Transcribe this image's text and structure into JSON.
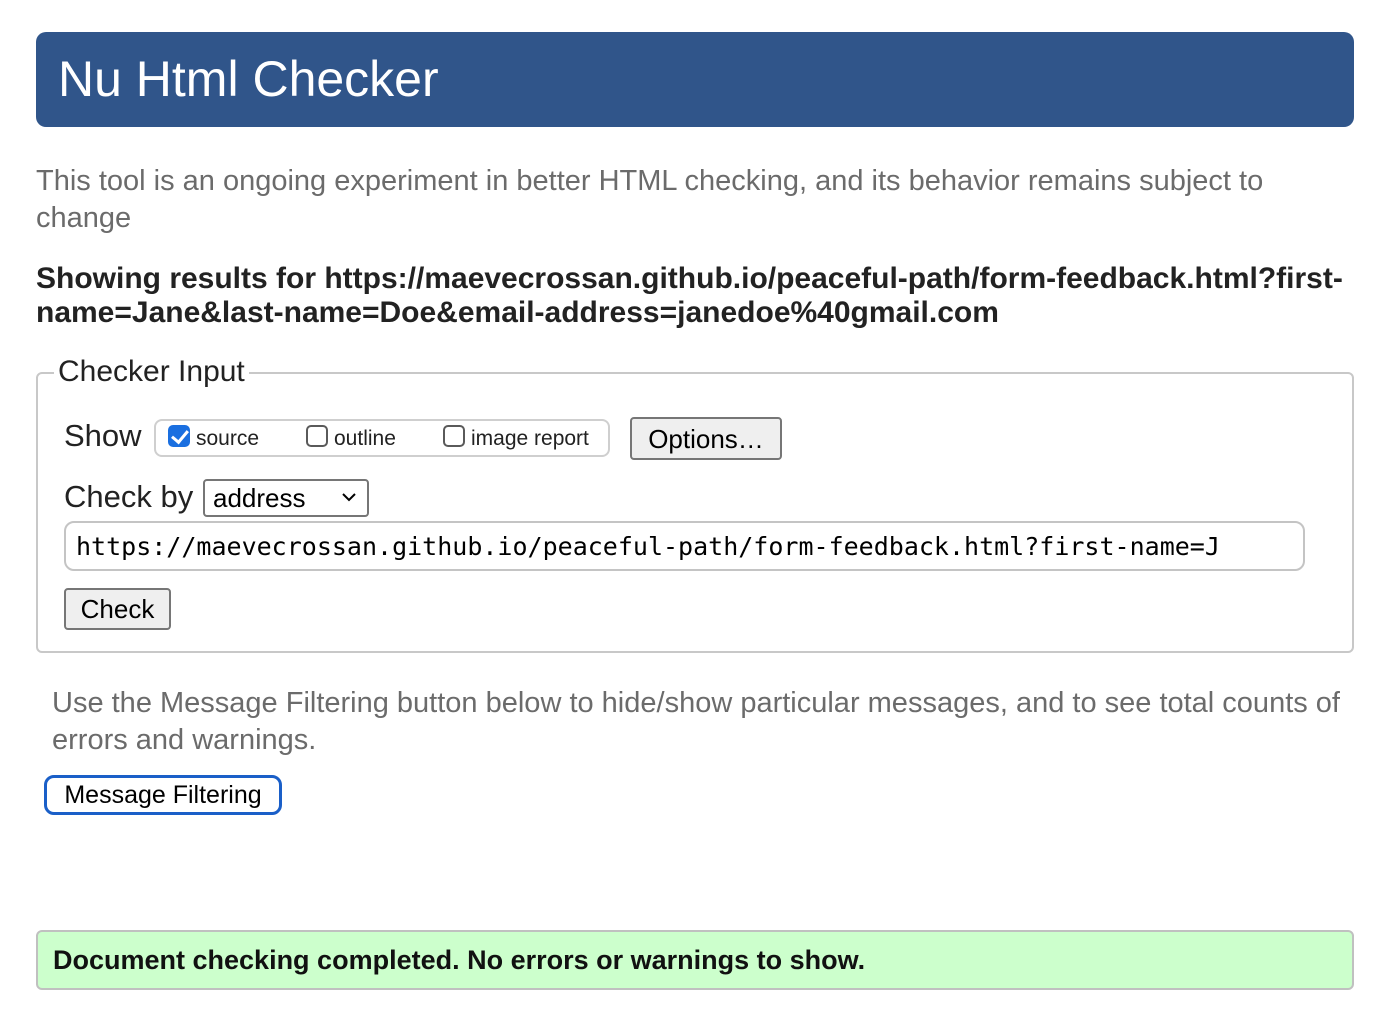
{
  "header": {
    "title": "Nu Html Checker",
    "color": "#30558a"
  },
  "intro": {
    "text": "This tool is an ongoing experiment in better HTML checking, and its behavior remains subject to change"
  },
  "results": {
    "heading": "Showing results for https://maevecrossan.github.io/peaceful-path/form-feedback.html?first-name=Jane&last-name=Doe&email-address=janedoe%40gmail.com"
  },
  "checker_input": {
    "legend": "Checker Input",
    "show_label": "Show",
    "show_options": [
      {
        "label": "source",
        "checked": true
      },
      {
        "label": "outline",
        "checked": false
      },
      {
        "label": "image report",
        "checked": false
      }
    ],
    "options_button": "Options…",
    "check_by_label": "Check by",
    "check_by_value": "address",
    "url_value": "https://maevecrossan.github.io/peaceful-path/form-feedback.html?first-name=J",
    "check_button": "Check"
  },
  "filtering": {
    "note": "Use the Message Filtering button below to hide/show particular messages, and to see total counts of errors and warnings.",
    "button": "Message Filtering",
    "focus_color": "#1a5fc8"
  },
  "status": {
    "message": "Document checking completed. No errors or warnings to show.",
    "color": "#ccffcc"
  }
}
